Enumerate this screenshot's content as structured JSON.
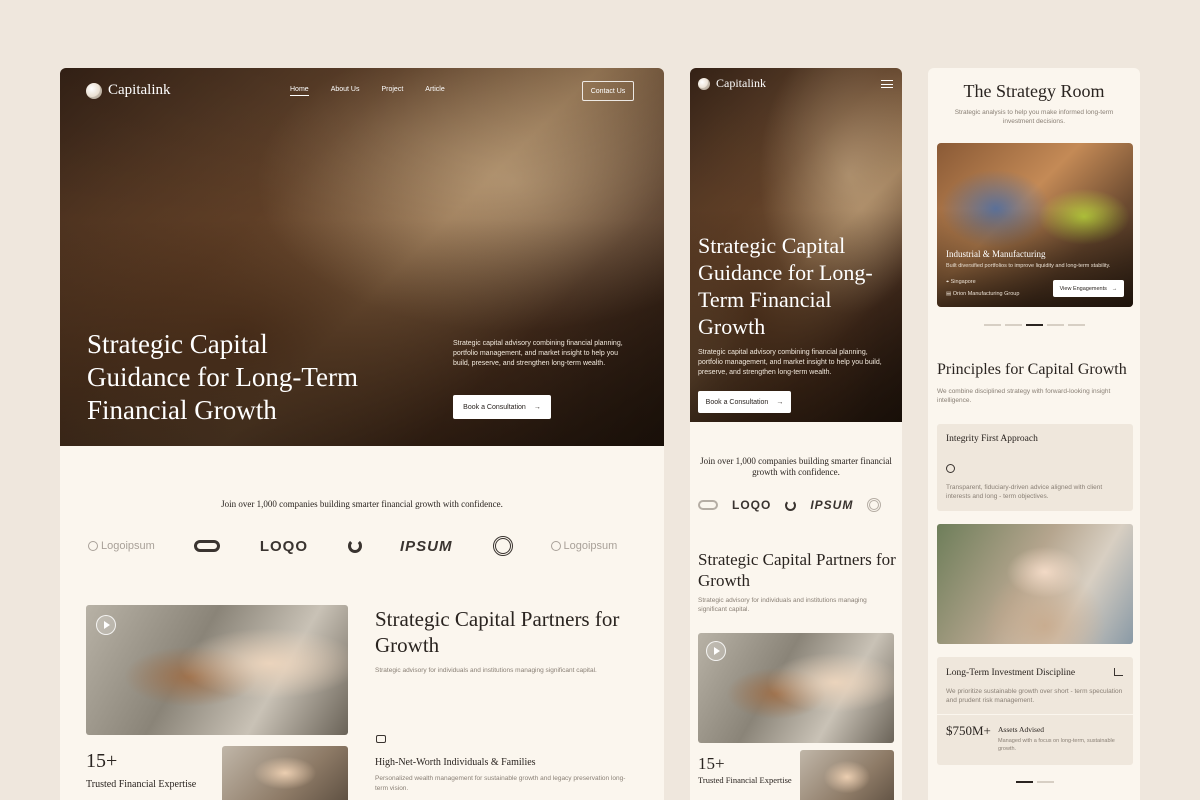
{
  "brand": {
    "name": "Capitalink"
  },
  "nav": {
    "items": [
      "Home",
      "About Us",
      "Project",
      "Article"
    ],
    "contact_label": "Contact Us"
  },
  "hero": {
    "title": "Strategic Capital Guidance for Long-Term Financial Growth",
    "description": "Strategic capital advisory combining financial planning, portfolio management, and market insight to help you build, preserve, and strengthen long-term wealth.",
    "button_label": "Book a Consultation",
    "button_icon": "arrow-right-icon"
  },
  "trust": {
    "text": "Join over 1,000 companies building smarter financial growth with confidence.",
    "logos": [
      "Logoipsum",
      "LOQO",
      "IPSUM",
      "Logoipsum"
    ]
  },
  "partners": {
    "title": "Strategic Capital Partners for Growth",
    "subtitle": "Strategic advisory for individuals and institutions managing significant capital."
  },
  "stats": {
    "number": "15+",
    "label": "Trusted Financial Expertise"
  },
  "feature": {
    "icon": "wallet-icon",
    "title": "High-Net-Worth Individuals & Families",
    "description": "Personalized wealth management for sustainable growth and legacy preservation long-term vision."
  },
  "strategy_room": {
    "title": "The Strategy Room",
    "subtitle": "Strategic analysis to help you make informed long-term investment decisions.",
    "card": {
      "title": "Industrial & Manufacturing",
      "description": "Built diversified portfolios to improve liquidity and long-term stability.",
      "location": "Singapore",
      "client": "Orion Manufacturing Group",
      "button_label": "View Engagements",
      "button_icon": "arrow-right-icon"
    },
    "carousel_pages": 5,
    "carousel_active": 3
  },
  "principles": {
    "title": "Principles for Capital Growth",
    "subtitle": "We combine disciplined strategy with forward-looking insight intelligence.",
    "card1": {
      "title": "Integrity First Approach",
      "icon": "fingerprint-icon",
      "description": "Transparent, fiduciary-driven advice aligned with client interests and long - term objectives."
    },
    "card2": {
      "title": "Long-Term Investment Discipline",
      "icon": "chart-icon",
      "description": "We prioritize sustainable growth over short - term speculation and prudent risk management.",
      "aum_value": "$750M+",
      "aum_title": "Assets Advised",
      "aum_description": "Managed with a focus on long-term, sustainable growth."
    }
  },
  "colors": {
    "background": "#efe7dd",
    "panel": "#fbf6ee",
    "card": "#efe7dc",
    "text": "#2a2420",
    "muted": "#8a8076"
  }
}
